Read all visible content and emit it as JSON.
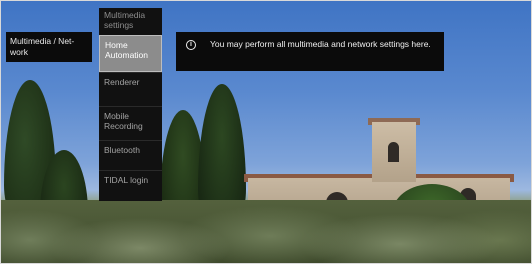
{
  "breadcrumb": {
    "label": "Multimedia / Net-work"
  },
  "menu": {
    "header": "Multimedia settings",
    "items": [
      {
        "label": "Home Automation",
        "selected": true
      },
      {
        "label": "Renderer",
        "selected": false
      },
      {
        "label": "Mobile Recording",
        "selected": false
      },
      {
        "label": "Bluetooth",
        "selected": false
      },
      {
        "label": "TIDAL login",
        "selected": false
      }
    ]
  },
  "info": {
    "icon": "info-icon",
    "text": "You may perform all multimedia and network settings here."
  },
  "colors": {
    "panel": "#0b0b0b",
    "selected": "#8c8c8c"
  }
}
